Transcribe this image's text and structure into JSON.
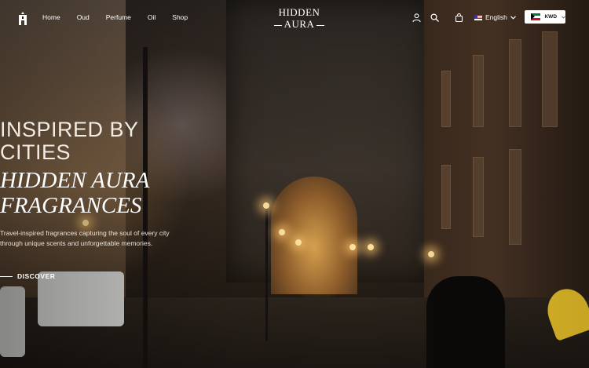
{
  "header": {
    "nav": [
      "Home",
      "Oud",
      "Perfume",
      "Oil",
      "Shop"
    ],
    "brand": {
      "line1": "HIDDEN",
      "line2": "AURA"
    },
    "language": "English",
    "currency": "KWD"
  },
  "hero": {
    "eyebrow": "INSPIRED BY CITIES",
    "headline": "HIDDEN AURA FRAGRANCES",
    "description": "Travel-inspired fragrances capturing the soul of every city through unique scents and unforgettable memories.",
    "cta": "DISCOVER"
  },
  "icons": [
    "logo-mark-icon",
    "account-icon",
    "search-icon",
    "cart-icon",
    "chevron-down-icon",
    "arrow-line-icon"
  ]
}
